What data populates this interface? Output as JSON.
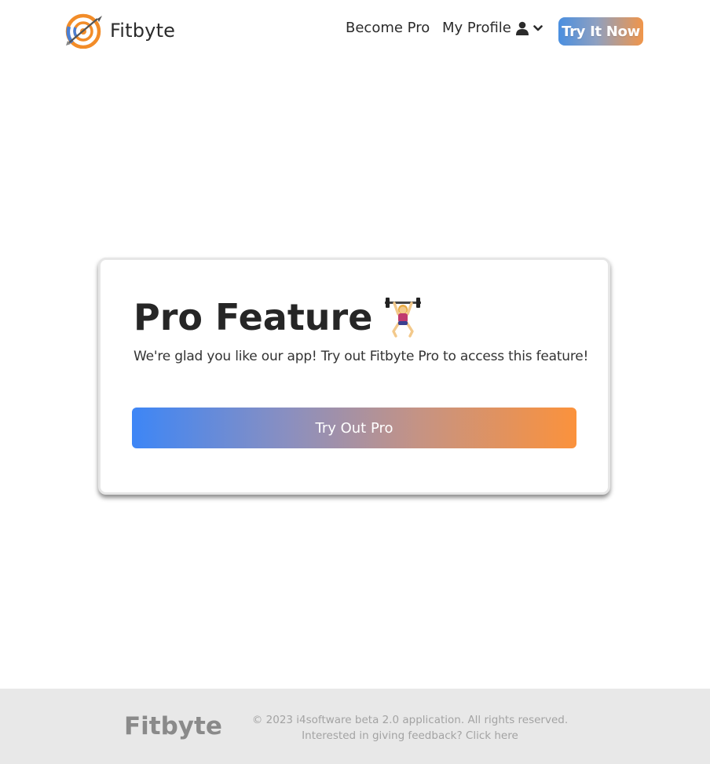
{
  "header": {
    "brand_name": "Fitbyte",
    "logo_icon": "target-arrow-logo-icon",
    "nav": {
      "become_pro": "Become Pro",
      "my_profile": "My Profile",
      "profile_icon": "user-icon",
      "dropdown_icon": "chevron-down-icon"
    },
    "cta_label": "Try It Now"
  },
  "card": {
    "title": "Pro Feature",
    "title_icon": "weightlifter-emoji",
    "message": "We're glad you like our app! Try out Fitbyte Pro to access this feature!",
    "button_label": "Try Out Pro"
  },
  "footer": {
    "brand_name": "Fitbyte",
    "copyright": "© 2023 i4software beta 2.0 application. All rights reserved.",
    "feedback_prefix": "Interested in giving feedback?",
    "feedback_link": "Click here"
  },
  "colors": {
    "gradient_start": "#3d86f6",
    "gradient_end": "#fb923c",
    "footer_bg": "#e8e8e8"
  }
}
